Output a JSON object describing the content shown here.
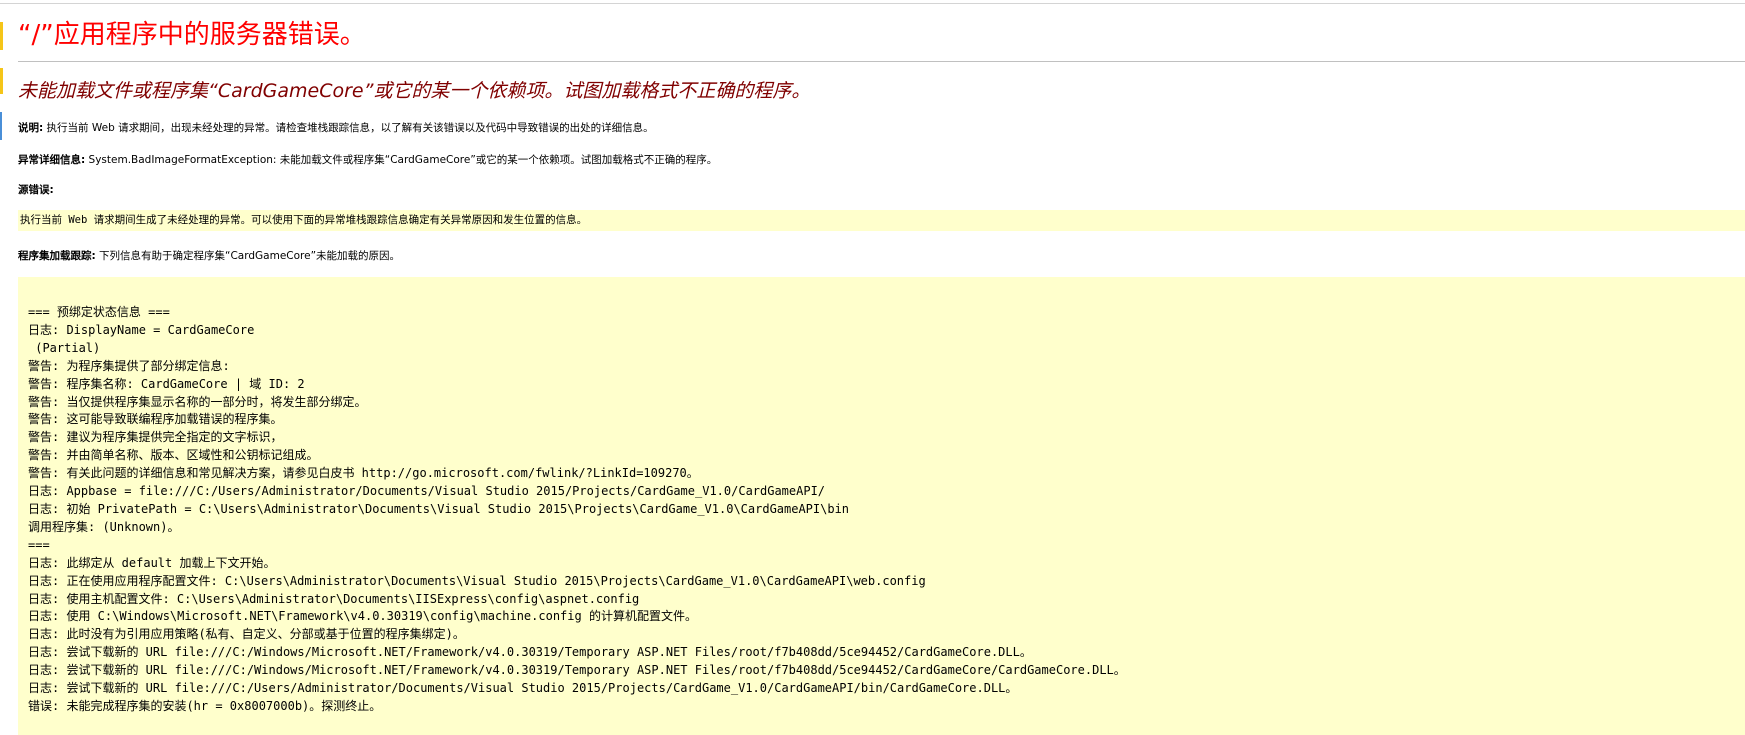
{
  "title": "“/”应用程序中的服务器错误。",
  "subtitle": "未能加载文件或程序集“CardGameCore”或它的某一个依赖项。试图加载格式不正确的程序。",
  "description": {
    "label": "说明:",
    "text": " 执行当前 Web 请求期间，出现未经处理的异常。请检查堆栈跟踪信息，以了解有关该错误以及代码中导致错误的出处的详细信息。"
  },
  "exception_details": {
    "label": "异常详细信息:",
    "text": " System.BadImageFormatException: 未能加载文件或程序集“CardGameCore”或它的某一个依赖项。试图加载格式不正确的程序。"
  },
  "source_error": {
    "label": "源错误:",
    "text": "执行当前 Web 请求期间生成了未经处理的异常。可以使用下面的异常堆栈跟踪信息确定有关异常原因和发生位置的信息。"
  },
  "assembly_trace": {
    "label": "程序集加载跟踪:",
    "text": " 下列信息有助于确定程序集“CardGameCore”未能加载的原因。"
  },
  "trace_lines": [
    "=== 预绑定状态信息 ===",
    "日志: DisplayName = CardGameCore",
    " (Partial)",
    "警告: 为程序集提供了部分绑定信息:",
    "警告: 程序集名称: CardGameCore | 域 ID: 2",
    "警告: 当仅提供程序集显示名称的一部分时，将发生部分绑定。",
    "警告: 这可能导致联编程序加载错误的程序集。",
    "警告: 建议为程序集提供完全指定的文字标识，",
    "警告: 并由简单名称、版本、区域性和公钥标记组成。",
    "警告: 有关此问题的详细信息和常见解决方案，请参见白皮书 http://go.microsoft.com/fwlink/?LinkId=109270。",
    "日志: Appbase = file:///C:/Users/Administrator/Documents/Visual Studio 2015/Projects/CardGame_V1.0/CardGameAPI/",
    "日志: 初始 PrivatePath = C:\\Users\\Administrator\\Documents\\Visual Studio 2015\\Projects\\CardGame_V1.0\\CardGameAPI\\bin",
    "调用程序集: (Unknown)。",
    "===",
    "日志: 此绑定从 default 加载上下文开始。",
    "日志: 正在使用应用程序配置文件: C:\\Users\\Administrator\\Documents\\Visual Studio 2015\\Projects\\CardGame_V1.0\\CardGameAPI\\web.config",
    "日志: 使用主机配置文件: C:\\Users\\Administrator\\Documents\\IISExpress\\config\\aspnet.config",
    "日志: 使用 C:\\Windows\\Microsoft.NET\\Framework\\v4.0.30319\\config\\machine.config 的计算机配置文件。",
    "日志: 此时没有为引用应用策略(私有、自定义、分部或基于位置的程序集绑定)。",
    "日志: 尝试下载新的 URL file:///C:/Windows/Microsoft.NET/Framework/v4.0.30319/Temporary ASP.NET Files/root/f7b408dd/5ce94452/CardGameCore.DLL。",
    "日志: 尝试下载新的 URL file:///C:/Windows/Microsoft.NET/Framework/v4.0.30319/Temporary ASP.NET Files/root/f7b408dd/5ce94452/CardGameCore/CardGameCore.DLL。",
    "日志: 尝试下载新的 URL file:///C:/Users/Administrator/Documents/Visual Studio 2015/Projects/CardGame_V1.0/CardGameAPI/bin/CardGameCore.DLL。",
    "错误: 未能完成程序集的安装(hr = 0x8007000b)。探测终止。"
  ],
  "colors": {
    "title": "#ff0000",
    "subtitle": "#800000",
    "highlight_bg": "#ffffcc"
  }
}
